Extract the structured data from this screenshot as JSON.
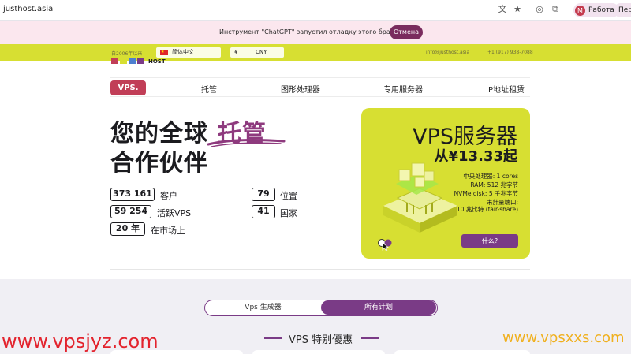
{
  "browser": {
    "url": "justhost.asia",
    "profile_label": "Работа",
    "profile_initial": "М",
    "profile2_label": "Пер"
  },
  "debug_banner": {
    "message": "Инструмент \"ChatGPT\" запустил отладку этого браузера.",
    "cancel_label": "Отмена"
  },
  "topband": {
    "since": "自2006年以来",
    "language": "简体中文",
    "currency_symbol": "¥",
    "currency_code": "CNY",
    "email": "info@justhost.asia",
    "phone": "+1 (917) 938-7088"
  },
  "logo_text": "HOST",
  "nav": {
    "vps": "VPS.",
    "items": [
      "托管",
      "图形处理器",
      "专用服务器",
      "IP地址租赁"
    ]
  },
  "hero": {
    "line1": "您的全球",
    "accent": "托管",
    "line2": "合作伙伴"
  },
  "stats": [
    {
      "value": "373 161",
      "label": "客户"
    },
    {
      "value": "59 254",
      "label": "活跃VPS"
    },
    {
      "value": "20 年",
      "label": "在市场上"
    },
    {
      "value": "79",
      "label": "位置"
    },
    {
      "value": "41",
      "label": "国家"
    }
  ],
  "vps_card": {
    "title": "VPS服务器",
    "price": "从¥13.33起",
    "specs": [
      "中央处理器: 1 cores",
      "RAM: 512 兆字节",
      "NVMe disk: 5 千兆字节",
      "未計量端口:",
      "10 兆比特 (fair-share)"
    ],
    "button": "什么?"
  },
  "lower": {
    "toggle_left": "Vps 生成器",
    "toggle_right": "所有计划",
    "offers_title": "VPS 特别優惠"
  },
  "watermarks": {
    "left": "www.vpsjyz.com",
    "right": "www.vpsxxs.com"
  },
  "colors": {
    "accent_lime": "#d7df32",
    "brand_purple": "#7a3b86",
    "brand_red": "#c13e57"
  }
}
